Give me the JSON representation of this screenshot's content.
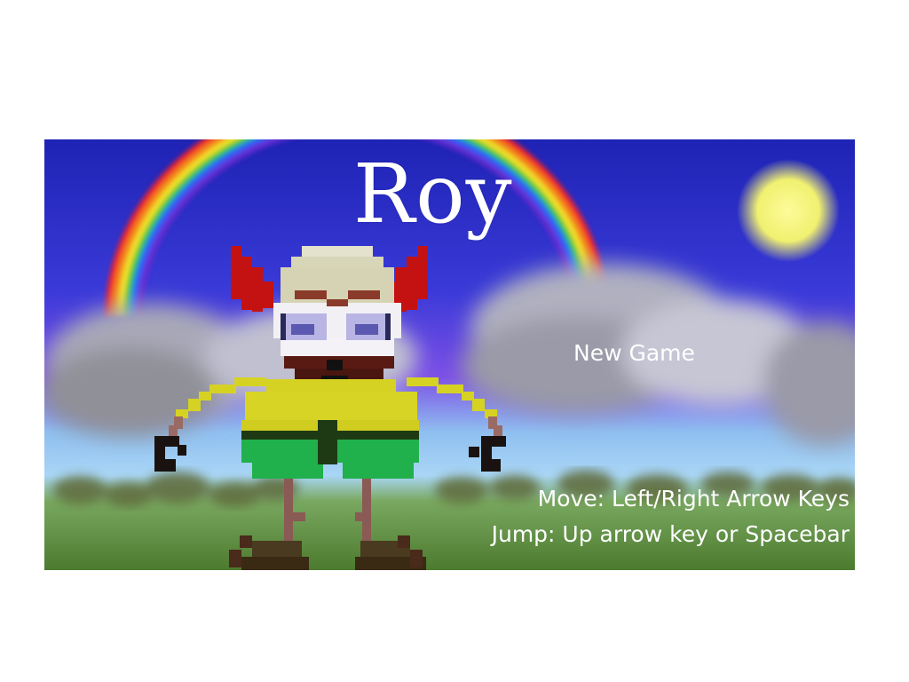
{
  "game": {
    "title": "Roy",
    "menu": {
      "new_game_label": "New Game"
    },
    "controls": {
      "move": "Move: Left/Right Arrow Keys",
      "jump": "Jump: Up arrow key or Spacebar"
    }
  },
  "colors": {
    "sky_top": "#1a1fb8",
    "sky_mid": "#4a48e0",
    "horizon": "#8fc7f2",
    "grass": "#4f7a32",
    "sun": "#f4f48a",
    "text": "#ffffff",
    "roy_hat_red": "#c41212",
    "roy_face": "#e2e0c2",
    "roy_shirt": "#d6d224",
    "roy_shorts": "#20b04c",
    "roy_beard": "#5a1a14"
  }
}
